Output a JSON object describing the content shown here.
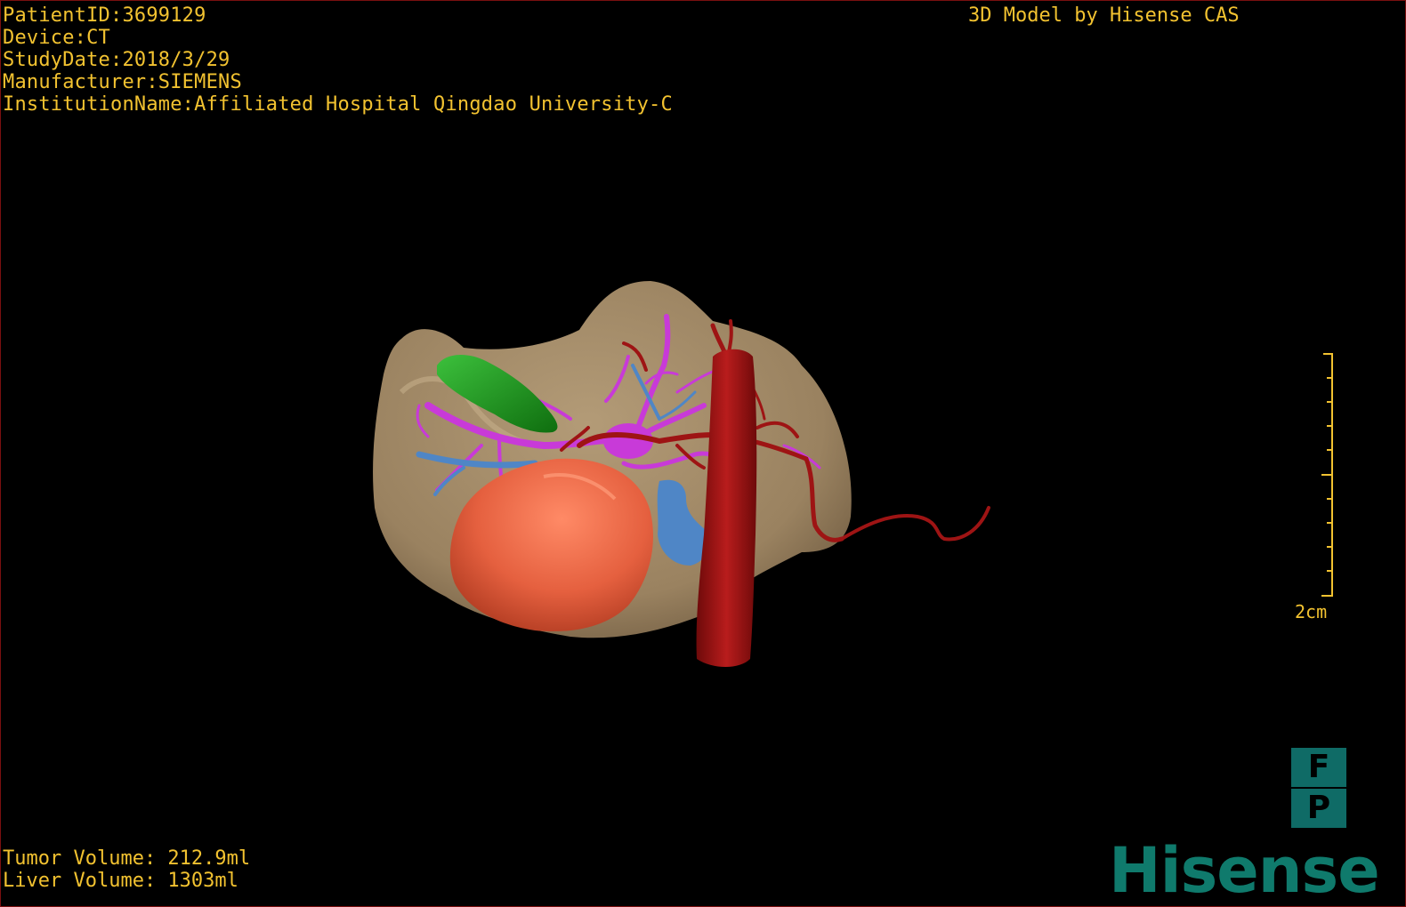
{
  "patient": {
    "id_line": "PatientID:3699129",
    "device_line": "Device:CT",
    "study_date_line": "StudyDate:2018/3/29",
    "manufacturer_line": "Manufacturer:SIEMENS",
    "institution_line": "InstitutionName:Affiliated Hospital Qingdao University-C"
  },
  "credit": "3D Model by Hisense CAS",
  "scale": {
    "label": "2cm"
  },
  "volumes": {
    "tumor": "Tumor Volume: 212.9ml",
    "liver": "Liver Volume: 1303ml"
  },
  "orientation": {
    "top": "F",
    "bottom": "P"
  },
  "brand": "Hisense",
  "colors": {
    "overlay_text": "#f2c230",
    "liver": "#9c8461",
    "tumor": "#e5603f",
    "gallbladder": "#1f9a1f",
    "hepatic_veins": "#c83ad8",
    "portal_vein": "#4f86c6",
    "artery": "#9e1414",
    "brand": "#0f7a6c"
  }
}
